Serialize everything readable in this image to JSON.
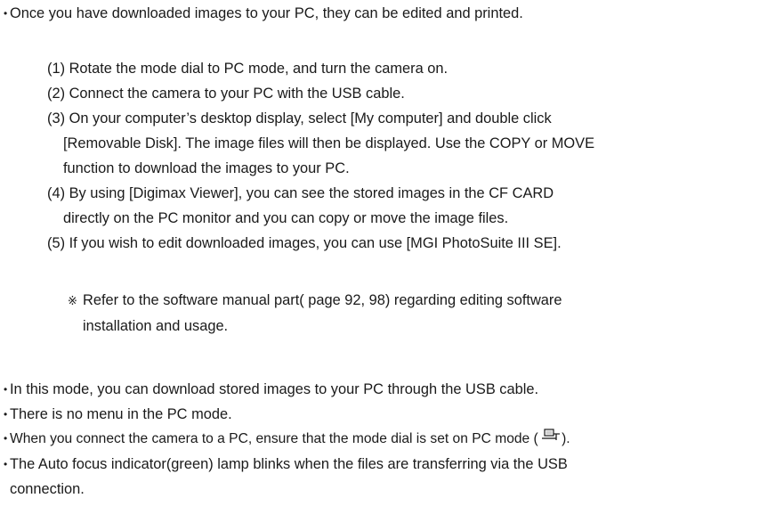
{
  "intro": {
    "bullet": "•",
    "text": "Once you have downloaded images to your PC, they can be edited and printed."
  },
  "steps": [
    {
      "lines": [
        "(1) Rotate the mode dial to PC mode, and turn the camera on."
      ]
    },
    {
      "lines": [
        "(2) Connect the camera to your PC with the USB cable."
      ]
    },
    {
      "lines": [
        "(3) On your computer’s desktop display, select [My computer] and double click",
        "[Removable Disk]. The image files will then be displayed. Use the COPY or MOVE",
        "function to download the images to your PC."
      ]
    },
    {
      "lines": [
        "(4) By using [Digimax Viewer], you can see the stored images in the CF CARD",
        "directly on the PC monitor and you can copy or move the image files."
      ]
    },
    {
      "lines": [
        "(5) If you wish to edit downloaded images, you can use [MGI PhotoSuite III SE]."
      ]
    }
  ],
  "note": {
    "mark": "※",
    "lines": [
      "Refer to the software manual part( page 92, 98) regarding editing software",
      "installation and usage."
    ]
  },
  "bullets": [
    {
      "lines": [
        "In this mode, you can download stored images to your PC through the USB cable."
      ]
    },
    {
      "lines": [
        "There is no menu in the PC mode."
      ]
    },
    {
      "lines": [
        "When you connect the camera to a PC, ensure that the mode dial is set on PC mode (",
        ")."
      ],
      "icon": "pc-mode-icon"
    },
    {
      "lines": [
        "The Auto focus indicator(green) lamp blinks when the files are transferring via the USB",
        "connection."
      ]
    }
  ]
}
